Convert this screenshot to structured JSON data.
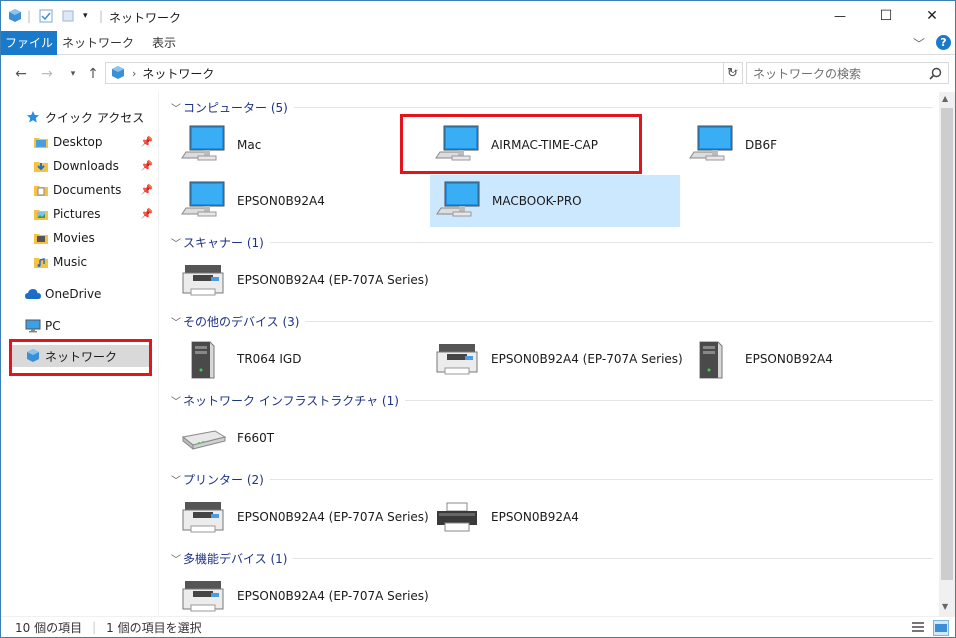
{
  "window": {
    "title": "ネットワーク",
    "controls": {
      "minimize": "—",
      "maximize": "☐",
      "close": "✕"
    }
  },
  "ribbon": {
    "tabs": [
      "ファイル",
      "ネットワーク",
      "表示"
    ],
    "help_label": "?"
  },
  "address": {
    "path": "ネットワーク",
    "search_placeholder": "ネットワークの検索"
  },
  "sidebar": {
    "items": [
      {
        "label": "クイック アクセス",
        "icon": "star-icon"
      },
      {
        "label": "Desktop",
        "icon": "folder-icon",
        "pinned": true
      },
      {
        "label": "Downloads",
        "icon": "download-folder-icon",
        "pinned": true
      },
      {
        "label": "Documents",
        "icon": "documents-folder-icon",
        "pinned": true
      },
      {
        "label": "Pictures",
        "icon": "pictures-folder-icon",
        "pinned": true
      },
      {
        "label": "Movies",
        "icon": "folder-icon"
      },
      {
        "label": "Music",
        "icon": "music-folder-icon"
      },
      {
        "label": "OneDrive",
        "icon": "cloud-icon"
      },
      {
        "label": "PC",
        "icon": "computer-icon"
      },
      {
        "label": "ネットワーク",
        "icon": "network-icon",
        "selected": true
      }
    ]
  },
  "groups": [
    {
      "label": "コンピューター (5)",
      "items": [
        "Mac",
        "AIRMAC-TIME-CAP",
        "DB6F",
        "EPSON0B92A4",
        "MACBOOK-PRO"
      ]
    },
    {
      "label": "スキャナー (1)",
      "items": [
        "EPSON0B92A4 (EP-707A Series)"
      ]
    },
    {
      "label": "その他のデバイス (3)",
      "items": [
        "TR064 IGD",
        "EPSON0B92A4 (EP-707A Series)",
        "EPSON0B92A4"
      ]
    },
    {
      "label": "ネットワーク インフラストラクチャ (1)",
      "items": [
        "F660T"
      ]
    },
    {
      "label": "プリンター (2)",
      "items": [
        "EPSON0B92A4 (EP-707A Series)",
        "EPSON0B92A4"
      ]
    },
    {
      "label": "多機能デバイス (1)",
      "items": [
        "EPSON0B92A4 (EP-707A Series)"
      ]
    }
  ],
  "status": {
    "count": "10 個の項目",
    "selected": "1 個の項目を選択"
  },
  "colors": {
    "accent": "#1979ca",
    "highlight": "#e3141b",
    "selection": "#cce8ff",
    "group_label": "#1e3287"
  }
}
